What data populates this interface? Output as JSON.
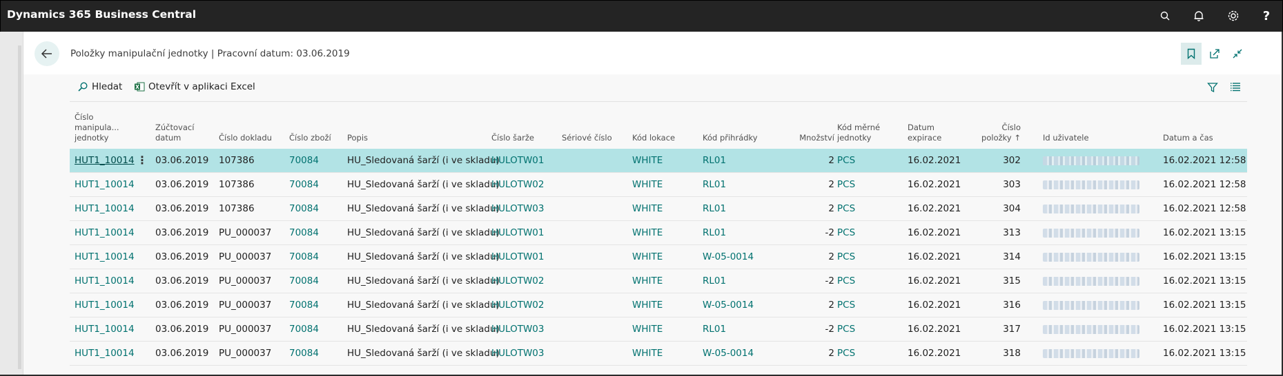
{
  "app": {
    "title": "Dynamics 365 Business Central"
  },
  "page": {
    "title": "Položky manipulační jednotky | Pracovní datum: 03.06.2019"
  },
  "actions": {
    "search": "Hledat",
    "excel": "Otevřít v aplikaci Excel"
  },
  "columns": {
    "hu": [
      "Číslo",
      "manipula...",
      "jednotky"
    ],
    "posting_date": [
      "Zúčtovací",
      "datum"
    ],
    "document_no": "Číslo dokladu",
    "item_no": "Číslo zboží",
    "description": "Popis",
    "lot_no": "Číslo šarže",
    "serial_no": "Sériové číslo",
    "location": "Kód lokace",
    "bin": "Kód přihrádky",
    "quantity": "Množství",
    "uom": [
      "Kód měrné",
      "jednotky"
    ],
    "expiry": [
      "Datum",
      "expirace"
    ],
    "entry_no": [
      "Číslo",
      "položky ↑"
    ],
    "user_id": "Id uživatele",
    "datetime": "Datum a čas"
  },
  "rows": [
    {
      "hu": "HUT1_10014",
      "date": "03.06.2019",
      "doc": "107386",
      "item": "70084",
      "desc": "HU_Sledovaná šarží (i ve skladu)",
      "lot": "HULOTW01",
      "serial": "",
      "loc": "WHITE",
      "bin": "RL01",
      "qty": "2",
      "uom": "PCS",
      "exp": "16.02.2021",
      "entry": "302",
      "dt": "16.02.2021 12:58"
    },
    {
      "hu": "HUT1_10014",
      "date": "03.06.2019",
      "doc": "107386",
      "item": "70084",
      "desc": "HU_Sledovaná šarží (i ve skladu)",
      "lot": "HULOTW02",
      "serial": "",
      "loc": "WHITE",
      "bin": "RL01",
      "qty": "2",
      "uom": "PCS",
      "exp": "16.02.2021",
      "entry": "303",
      "dt": "16.02.2021 12:58"
    },
    {
      "hu": "HUT1_10014",
      "date": "03.06.2019",
      "doc": "107386",
      "item": "70084",
      "desc": "HU_Sledovaná šarží (i ve skladu)",
      "lot": "HULOTW03",
      "serial": "",
      "loc": "WHITE",
      "bin": "RL01",
      "qty": "2",
      "uom": "PCS",
      "exp": "16.02.2021",
      "entry": "304",
      "dt": "16.02.2021 12:58"
    },
    {
      "hu": "HUT1_10014",
      "date": "03.06.2019",
      "doc": "PU_000037",
      "item": "70084",
      "desc": "HU_Sledovaná šarží (i ve skladu)",
      "lot": "HULOTW01",
      "serial": "",
      "loc": "WHITE",
      "bin": "RL01",
      "qty": "-2",
      "uom": "PCS",
      "exp": "16.02.2021",
      "entry": "313",
      "dt": "16.02.2021 13:15"
    },
    {
      "hu": "HUT1_10014",
      "date": "03.06.2019",
      "doc": "PU_000037",
      "item": "70084",
      "desc": "HU_Sledovaná šarží (i ve skladu)",
      "lot": "HULOTW01",
      "serial": "",
      "loc": "WHITE",
      "bin": "W-05-0014",
      "qty": "2",
      "uom": "PCS",
      "exp": "16.02.2021",
      "entry": "314",
      "dt": "16.02.2021 13:15"
    },
    {
      "hu": "HUT1_10014",
      "date": "03.06.2019",
      "doc": "PU_000037",
      "item": "70084",
      "desc": "HU_Sledovaná šarží (i ve skladu)",
      "lot": "HULOTW02",
      "serial": "",
      "loc": "WHITE",
      "bin": "RL01",
      "qty": "-2",
      "uom": "PCS",
      "exp": "16.02.2021",
      "entry": "315",
      "dt": "16.02.2021 13:15"
    },
    {
      "hu": "HUT1_10014",
      "date": "03.06.2019",
      "doc": "PU_000037",
      "item": "70084",
      "desc": "HU_Sledovaná šarží (i ve skladu)",
      "lot": "HULOTW02",
      "serial": "",
      "loc": "WHITE",
      "bin": "W-05-0014",
      "qty": "2",
      "uom": "PCS",
      "exp": "16.02.2021",
      "entry": "316",
      "dt": "16.02.2021 13:15"
    },
    {
      "hu": "HUT1_10014",
      "date": "03.06.2019",
      "doc": "PU_000037",
      "item": "70084",
      "desc": "HU_Sledovaná šarží (i ve skladu)",
      "lot": "HULOTW03",
      "serial": "",
      "loc": "WHITE",
      "bin": "RL01",
      "qty": "-2",
      "uom": "PCS",
      "exp": "16.02.2021",
      "entry": "317",
      "dt": "16.02.2021 13:15"
    },
    {
      "hu": "HUT1_10014",
      "date": "03.06.2019",
      "doc": "PU_000037",
      "item": "70084",
      "desc": "HU_Sledovaná šarží (i ve skladu)",
      "lot": "HULOTW03",
      "serial": "",
      "loc": "WHITE",
      "bin": "W-05-0014",
      "qty": "2",
      "uom": "PCS",
      "exp": "16.02.2021",
      "entry": "318",
      "dt": "16.02.2021 13:15"
    }
  ],
  "selected_row": 0,
  "colors": {
    "accent": "#00716f",
    "selected_row": "#b2e3e5",
    "topbar": "#242424"
  },
  "icons": [
    "search-icon",
    "bell-icon",
    "gear-icon",
    "help-icon",
    "back-arrow-icon",
    "bookmark-icon",
    "share-icon",
    "collapse-icon",
    "excel-icon",
    "filter-icon",
    "list-view-icon"
  ]
}
